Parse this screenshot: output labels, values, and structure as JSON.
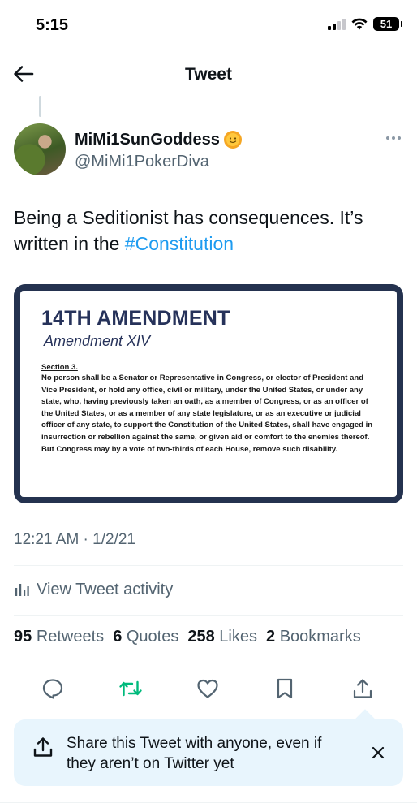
{
  "status_bar": {
    "time": "5:15",
    "battery": "51",
    "icons": [
      "signal-icon",
      "wifi-icon",
      "battery-icon"
    ]
  },
  "header": {
    "title": "Tweet",
    "back_icon": "arrow-left-icon"
  },
  "tweet": {
    "author": {
      "display_name": "MiMi1SunGoddess",
      "name_emoji": "sun-face-emoji",
      "handle": "@MiMi1PokerDiva"
    },
    "text_prefix": "Being a Seditionist has consequences. It’s written in the ",
    "hashtag": "#Constitution",
    "media": {
      "title": "14TH AMENDMENT",
      "subtitle": "Amendment XIV",
      "section_heading": "Section 3.",
      "section_body": "No person shall be a Senator or Representative in Congress, or elector of President and Vice President, or hold any office, civil or military, under the United States, or under any state, who, having previously taken an oath, as a member of Congress, or as an officer of the United States, or as a member of any state legislature, or as an executive or judicial officer of any state, to support the Constitution of the United States, shall have engaged in insurrection or rebellion against the same, or given aid or comfort to the enemies thereof. But Congress may by a vote of two-thirds of each House, remove such disability."
    },
    "timestamp": "12:21 AM · 1/2/21",
    "activity_label": "View Tweet activity",
    "stats": {
      "retweets_count": "95",
      "retweets_label": "Retweets",
      "quotes_count": "6",
      "quotes_label": "Quotes",
      "likes_count": "258",
      "likes_label": "Likes",
      "bookmarks_count": "2",
      "bookmarks_label": "Bookmarks"
    },
    "actions": [
      "reply-icon",
      "retweet-icon",
      "like-icon",
      "bookmark-icon",
      "share-icon"
    ]
  },
  "share_prompt": {
    "text": "Share this Tweet with anyone, even if they aren’t on Twitter yet"
  },
  "colors": {
    "accent": "#1d9bf0",
    "retweet_green": "#00ba7c",
    "secondary_text": "#536471",
    "media_frame": "#24324f",
    "share_card_bg": "#e8f5fd"
  }
}
